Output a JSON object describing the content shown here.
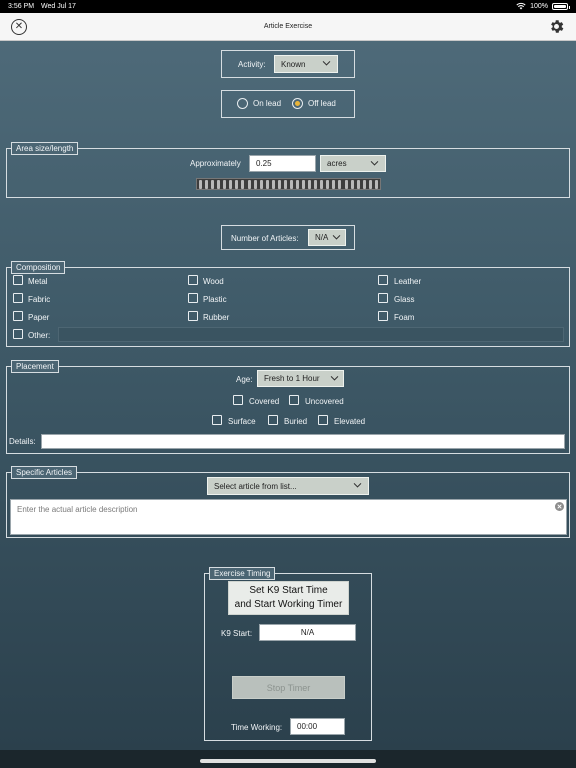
{
  "status_bar": {
    "time": "3:56 PM",
    "date": "Wed Jul 17",
    "battery": "100%"
  },
  "nav": {
    "title": "Article Exercise",
    "close_icon": "close-circle-icon",
    "settings_icon": "gear-icon"
  },
  "activity": {
    "label": "Activity:",
    "value": "Known"
  },
  "lead": {
    "options": [
      "On lead",
      "Off lead"
    ],
    "selected": "Off lead"
  },
  "area": {
    "legend": "Area size/length",
    "approx_label": "Approximately",
    "value": "0.25",
    "unit": "acres"
  },
  "articles_count": {
    "label": "Number of Articles:",
    "value": "N/A"
  },
  "composition": {
    "legend": "Composition",
    "items": [
      "Metal",
      "Wood",
      "Leather",
      "Fabric",
      "Plastic",
      "Glass",
      "Paper",
      "Rubber",
      "Foam"
    ],
    "other_label": "Other:"
  },
  "placement": {
    "legend": "Placement",
    "age_label": "Age:",
    "age_value": "Fresh to 1 Hour",
    "cover_options": [
      "Covered",
      "Uncovered"
    ],
    "position_options": [
      "Surface",
      "Buried",
      "Elevated"
    ],
    "details_label": "Details:"
  },
  "specific": {
    "legend": "Specific Articles",
    "select_placeholder": "Select article from list...",
    "description_placeholder": "Enter the actual article description"
  },
  "timing": {
    "legend": "Exercise Timing",
    "start_button_line1": "Set K9 Start Time",
    "start_button_line2": "and Start Working Timer",
    "k9_start_label": "K9 Start:",
    "k9_start_value": "N/A",
    "stop_button": "Stop Timer",
    "time_working_label": "Time Working:",
    "time_working_value": "00:00"
  },
  "colors": {
    "radio_selected": "#e8b43a",
    "background_top": "#506c7b",
    "background_bottom": "#2a3f4b"
  }
}
